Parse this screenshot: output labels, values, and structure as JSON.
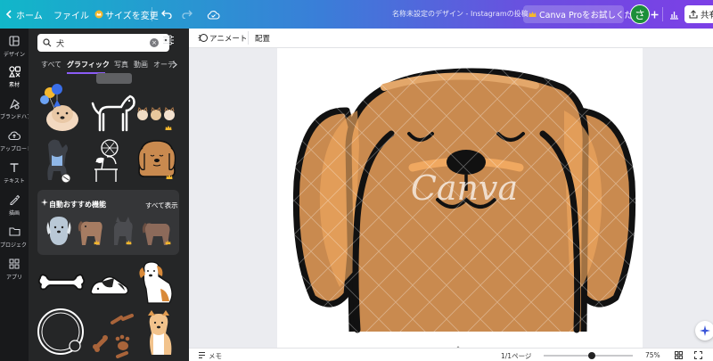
{
  "topbar": {
    "home_label": "ホーム",
    "file_label": "ファイル",
    "resize_label": "サイズを変更",
    "doc_title": "名称未設定のデザイン - Instagramの投稿",
    "pro_label": "Canva Proをお試しください",
    "avatar_letter": "さ",
    "share_label": "共有"
  },
  "rail": {
    "items": [
      {
        "label": "デザイン",
        "icon": "layout-icon"
      },
      {
        "label": "素材",
        "icon": "elements-icon"
      },
      {
        "label": "ブランドハブ",
        "icon": "brand-icon"
      },
      {
        "label": "アップロード",
        "icon": "upload-icon"
      },
      {
        "label": "テキスト",
        "icon": "text-icon"
      },
      {
        "label": "描画",
        "icon": "draw-icon"
      },
      {
        "label": "プロジェクト",
        "icon": "folder-icon"
      },
      {
        "label": "アプリ",
        "icon": "apps-icon"
      }
    ]
  },
  "panel": {
    "search_value": "犬",
    "tabs": [
      "すべて",
      "グラフィック",
      "写真",
      "動画",
      "オーデ"
    ],
    "active_tab": "グラフィック",
    "recommend_title": "自動おすすめ機能",
    "recommend_all": "すべて表示"
  },
  "context": {
    "animate_label": "アニメート",
    "position_label": "配置"
  },
  "canvas": {
    "watermark": "Canva",
    "colors": {
      "dog_fur": "#c98a4f",
      "outline": "#111111",
      "inner_ear": "#f0a860"
    }
  },
  "bottombar": {
    "notes_label": "メモ",
    "page_label": "1/1ページ",
    "zoom_label": "75%"
  },
  "colors": {
    "accent": "#8b5cf6",
    "panel_bg": "#252627",
    "rail_bg": "#18191b"
  }
}
